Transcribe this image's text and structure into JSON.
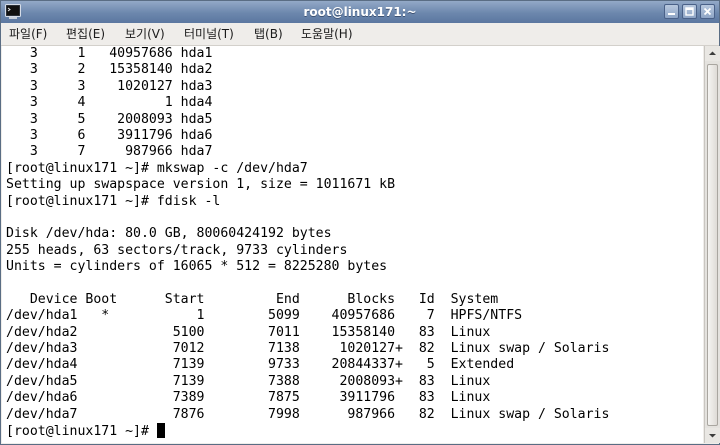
{
  "window": {
    "title": "root@linux171:~"
  },
  "menu": [
    {
      "label": "파일(F)"
    },
    {
      "label": "편집(E)"
    },
    {
      "label": "보기(V)"
    },
    {
      "label": "터미널(T)"
    },
    {
      "label": "탭(B)"
    },
    {
      "label": "도움말(H)"
    }
  ],
  "terminal": {
    "lines": [
      "   3     1   40957686 hda1",
      "   3     2   15358140 hda2",
      "   3     3    1020127 hda3",
      "   3     4          1 hda4",
      "   3     5    2008093 hda5",
      "   3     6    3911796 hda6",
      "   3     7     987966 hda7",
      "[root@linux171 ~]# mkswap -c /dev/hda7",
      "Setting up swapspace version 1, size = 1011671 kB",
      "[root@linux171 ~]# fdisk -l",
      "",
      "Disk /dev/hda: 80.0 GB, 80060424192 bytes",
      "255 heads, 63 sectors/track, 9733 cylinders",
      "Units = cylinders of 16065 * 512 = 8225280 bytes",
      "",
      "   Device Boot      Start         End      Blocks   Id  System",
      "/dev/hda1   *           1        5099    40957686    7  HPFS/NTFS",
      "/dev/hda2            5100        7011    15358140   83  Linux",
      "/dev/hda3            7012        7138     1020127+  82  Linux swap / Solaris",
      "/dev/hda4            7139        9733    20844337+   5  Extended",
      "/dev/hda5            7139        7388     2008093+  83  Linux",
      "/dev/hda6            7389        7875     3911796   83  Linux",
      "/dev/hda7            7876        7998      987966   82  Linux swap / Solaris"
    ],
    "prompt": "[root@linux171 ~]# "
  }
}
